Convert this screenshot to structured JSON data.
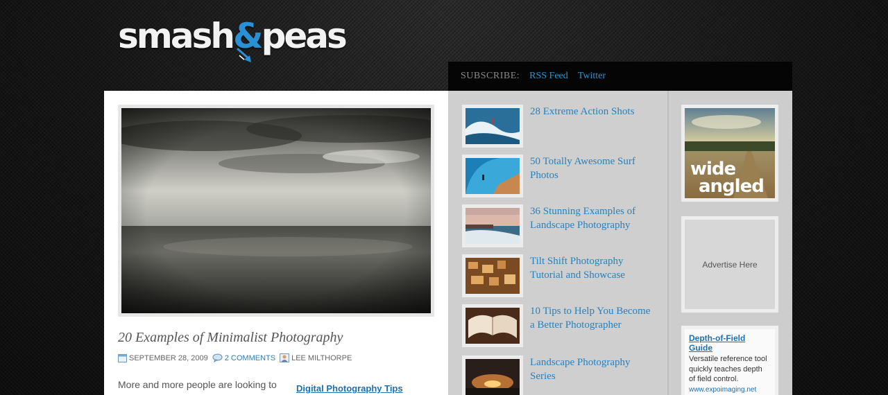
{
  "logo": {
    "left": "smash",
    "amp": "&",
    "right": "peas"
  },
  "subscribe": {
    "label": "SUBSCRIBE:",
    "links": [
      "RSS Feed",
      "Twitter"
    ]
  },
  "post": {
    "title": "20 Examples of Minimalist Photography",
    "date": "SEPTEMBER 28, 2009",
    "comments": "2 COMMENTS",
    "author": "LEE MILTHORPE",
    "excerpt": "More and more people are looking to",
    "side_link": "Digital Photography Tips"
  },
  "related": [
    {
      "title": "28 Extreme Action Shots",
      "thumb": "surfer-wave"
    },
    {
      "title": "50 Totally Awesome Surf Photos",
      "thumb": "surfer-blue"
    },
    {
      "title": "36 Stunning Examples of Landscape Photography",
      "thumb": "coast"
    },
    {
      "title": "Tilt Shift Photography Tutorial and Showcase",
      "thumb": "tilt-shift"
    },
    {
      "title": "10 Tips to Help You Become a Better Photographer",
      "thumb": "book"
    },
    {
      "title": "Landscape Photography Series",
      "thumb": "sunset"
    }
  ],
  "ads": {
    "banner_text": "wide angled",
    "placeholder": "Advertise Here",
    "text_ad": {
      "title": "Depth-of-Field Guide",
      "body": "Versatile reference tool quickly teaches depth of field control.",
      "url": "www.expoimaging.net"
    }
  },
  "colors": {
    "link": "#2781bd",
    "accent": "#2b8fd3",
    "bar": "#050505"
  }
}
